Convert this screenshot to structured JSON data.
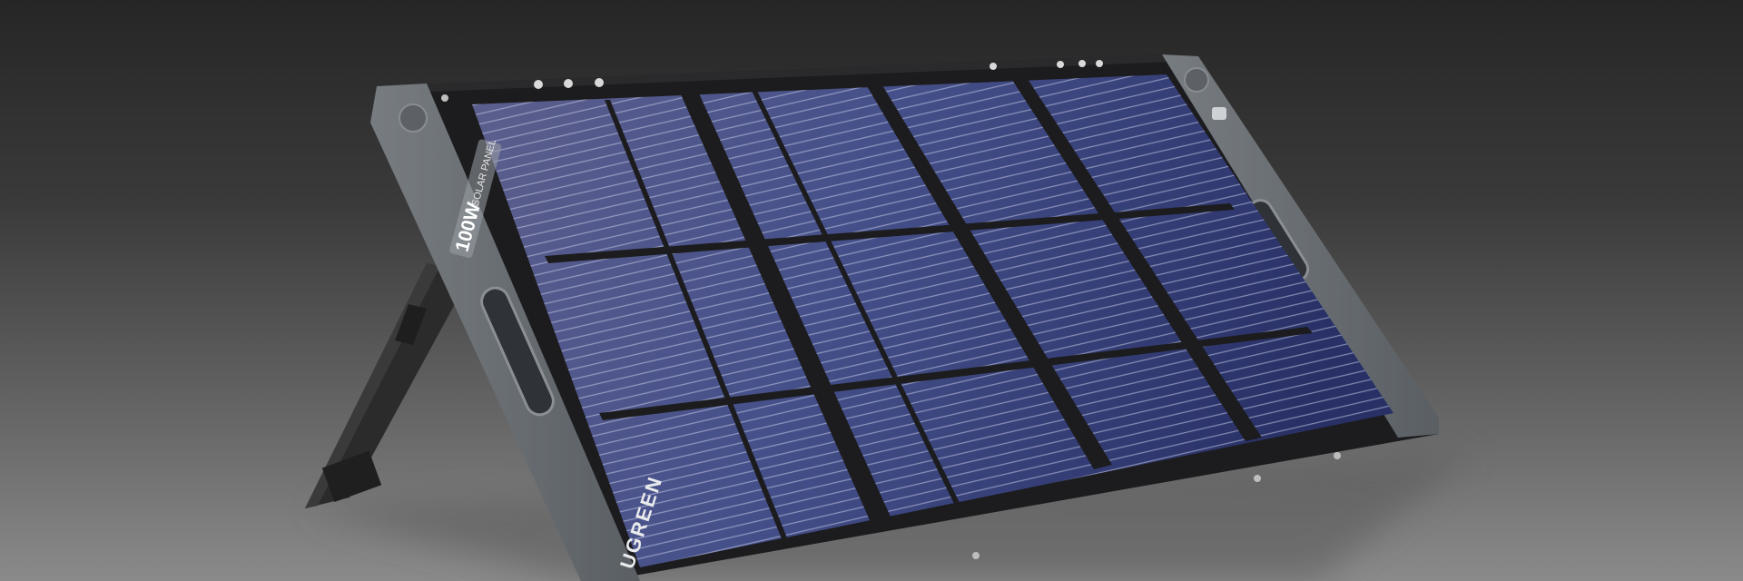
{
  "product": {
    "brand": "UGREEN",
    "power_label": "100W",
    "type_label": "SOLAR PANEL"
  },
  "colors": {
    "background_top": "#262626",
    "background_bottom": "#8a8a8a",
    "frame": "#1c1c1e",
    "end_cap": "#6d7277",
    "cell_light": "#5a5f8c",
    "cell_dark": "#283066",
    "kickstand": "#2a2a2a"
  }
}
